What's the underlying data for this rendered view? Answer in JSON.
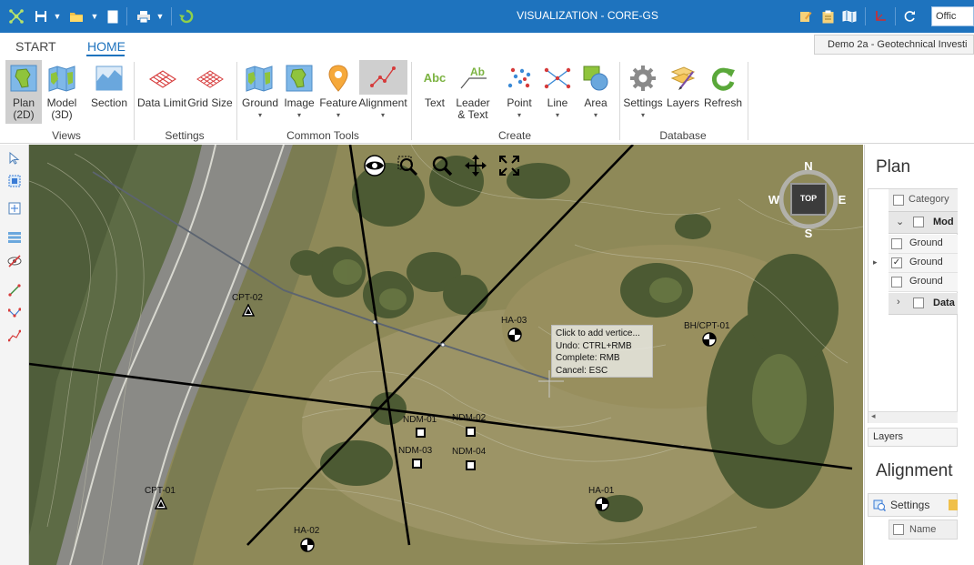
{
  "titlebar": {
    "title": "VISUALIZATION - CORE-GS",
    "search_value": "Offic"
  },
  "tabs": {
    "start": "START",
    "home": "HOME"
  },
  "project": {
    "name": "Demo 2a - Geotechnical Investi"
  },
  "ribbon": {
    "plan_l1": "Plan",
    "plan_l2": "(2D)",
    "model_l1": "Model",
    "model_l2": "(3D)",
    "section": "Section",
    "data_limit": "Data Limit",
    "grid_size": "Grid Size",
    "ground": "Ground",
    "image": "Image",
    "feature": "Feature",
    "alignment": "Alignment",
    "text": "Text",
    "leader_l1": "Leader",
    "leader_l2": "& Text",
    "point": "Point",
    "line": "Line",
    "area": "Area",
    "settings": "Settings",
    "layers": "Layers",
    "refresh": "Refresh",
    "groups": {
      "views": "Views",
      "settings": "Settings",
      "common_tools": "Common Tools",
      "create": "Create",
      "database": "Database"
    }
  },
  "compass": {
    "n": "N",
    "s": "S",
    "e": "E",
    "w": "W",
    "top": "TOP"
  },
  "map": {
    "points": [
      {
        "label": "CPT-02",
        "symbol": "triangle"
      },
      {
        "label": "HA-03",
        "symbol": "circle"
      },
      {
        "label": "BH/CPT-01",
        "symbol": "circle"
      },
      {
        "label": "NDM-01",
        "symbol": "square"
      },
      {
        "label": "NDM-02",
        "symbol": "square"
      },
      {
        "label": "NDM-03",
        "symbol": "square"
      },
      {
        "label": "NDM-04",
        "symbol": "square"
      },
      {
        "label": "CPT-01",
        "symbol": "triangle"
      },
      {
        "label": "HA-01",
        "symbol": "circle"
      },
      {
        "label": "HA-02",
        "symbol": "circle"
      }
    ],
    "tooltip": {
      "line1": "Click to add vertice...",
      "line2": "Undo: CTRL+RMB",
      "line3": "Complete: RMB",
      "line4": "Cancel: ESC"
    }
  },
  "plan_panel": {
    "title": "Plan",
    "column_header": "Category",
    "rows": [
      {
        "label": "Mod",
        "checked": false
      },
      {
        "label": "Ground",
        "checked": false
      },
      {
        "label": "Ground",
        "checked": true
      },
      {
        "label": "Ground",
        "checked": false
      },
      {
        "label": "Data",
        "checked": false
      }
    ],
    "layers_tab": "Layers"
  },
  "alignment_panel": {
    "title": "Alignment",
    "settings_label": "Settings",
    "column_header": "Name"
  },
  "colors": {
    "titlebar": "#1e73be",
    "accent": "#1e73be",
    "selected_button": "#cfcfcf"
  }
}
